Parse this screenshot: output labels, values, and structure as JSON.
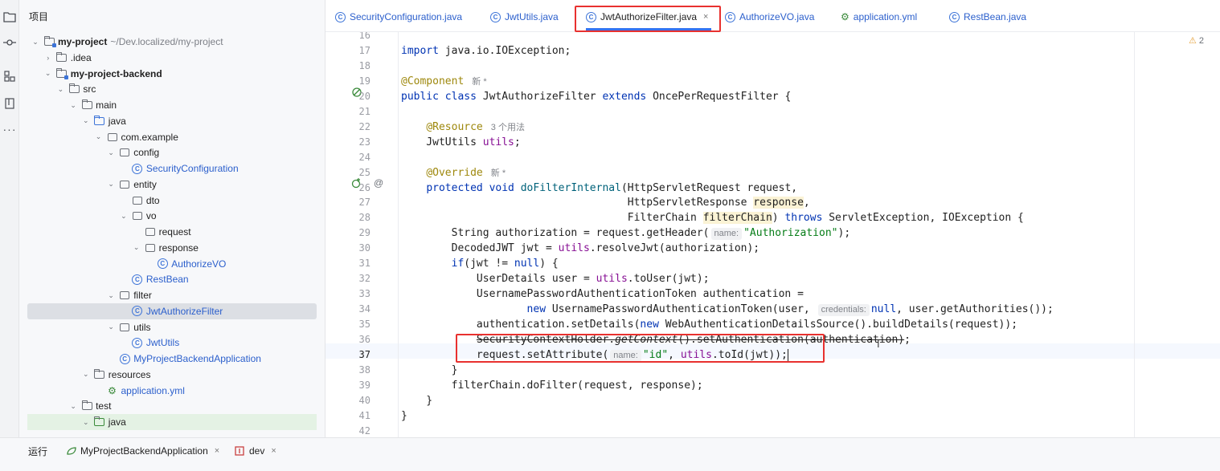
{
  "toolstrip": {
    "icons": [
      "folder-icon",
      "commit-icon",
      "structure-icon",
      "bookmark-icon",
      "more-icon"
    ]
  },
  "project": {
    "title": "项目",
    "tree": [
      {
        "label": "my-project",
        "suffix": "~/Dev.localized/my-project",
        "depth": 0,
        "expanded": true,
        "icon": "module",
        "bold": true
      },
      {
        "label": ".idea",
        "depth": 1,
        "expanded": false,
        "icon": "folder"
      },
      {
        "label": "my-project-backend",
        "depth": 1,
        "expanded": true,
        "icon": "module",
        "bold": true
      },
      {
        "label": "src",
        "depth": 2,
        "expanded": true,
        "icon": "folder"
      },
      {
        "label": "main",
        "depth": 3,
        "expanded": true,
        "icon": "folder"
      },
      {
        "label": "java",
        "depth": 4,
        "expanded": true,
        "icon": "folder-blue"
      },
      {
        "label": "com.example",
        "depth": 5,
        "expanded": true,
        "icon": "package"
      },
      {
        "label": "config",
        "depth": 6,
        "expanded": true,
        "icon": "package"
      },
      {
        "label": "SecurityConfiguration",
        "depth": 7,
        "icon": "class"
      },
      {
        "label": "entity",
        "depth": 6,
        "expanded": true,
        "icon": "package"
      },
      {
        "label": "dto",
        "depth": 7,
        "icon": "package"
      },
      {
        "label": "vo",
        "depth": 7,
        "expanded": true,
        "icon": "package"
      },
      {
        "label": "request",
        "depth": 8,
        "icon": "package"
      },
      {
        "label": "response",
        "depth": 8,
        "expanded": true,
        "icon": "package"
      },
      {
        "label": "AuthorizeVO",
        "depth": 9,
        "icon": "class"
      },
      {
        "label": "RestBean",
        "depth": 7,
        "icon": "class"
      },
      {
        "label": "filter",
        "depth": 6,
        "expanded": true,
        "icon": "package"
      },
      {
        "label": "JwtAuthorizeFilter",
        "depth": 7,
        "icon": "class",
        "selected": true
      },
      {
        "label": "utils",
        "depth": 6,
        "expanded": true,
        "icon": "package"
      },
      {
        "label": "JwtUtils",
        "depth": 7,
        "icon": "class"
      },
      {
        "label": "MyProjectBackendApplication",
        "depth": 6,
        "icon": "class"
      },
      {
        "label": "resources",
        "depth": 4,
        "expanded": true,
        "icon": "folder"
      },
      {
        "label": "application.yml",
        "depth": 5,
        "icon": "yml"
      },
      {
        "label": "test",
        "depth": 3,
        "expanded": true,
        "icon": "folder"
      },
      {
        "label": "java",
        "depth": 4,
        "expanded": true,
        "icon": "folder-green",
        "highlight": true
      }
    ]
  },
  "tabs": [
    {
      "label": "SecurityConfiguration.java",
      "icon": "class"
    },
    {
      "label": "JwtUtils.java",
      "icon": "class"
    },
    {
      "label": "JwtAuthorizeFilter.java",
      "icon": "class",
      "active": true,
      "close": "×"
    },
    {
      "label": "AuthorizeVO.java",
      "icon": "class"
    },
    {
      "label": "application.yml",
      "icon": "yml"
    },
    {
      "label": "RestBean.java",
      "icon": "class"
    }
  ],
  "editor": {
    "warnings": "2",
    "line_numbers": [
      "16",
      "17",
      "18",
      "19",
      "20",
      "21",
      "22",
      "23",
      "24",
      "25",
      "26",
      "27",
      "28",
      "29",
      "30",
      "31",
      "32",
      "33",
      "34",
      "35",
      "36",
      "37",
      "38",
      "39",
      "40",
      "41",
      "42"
    ],
    "meta_new": "新 *",
    "meta_usages": "3 个用法",
    "hint_name": "name:",
    "hint_credentials": "credentials:",
    "str_authorization": "\"Authorization\"",
    "str_id": "\"id\"",
    "current_line": "37"
  },
  "bottom": {
    "run_label": "运行",
    "run_tabs": [
      {
        "label": "MyProjectBackendApplication",
        "close": "×"
      },
      {
        "label": "dev",
        "close": "×"
      }
    ]
  }
}
